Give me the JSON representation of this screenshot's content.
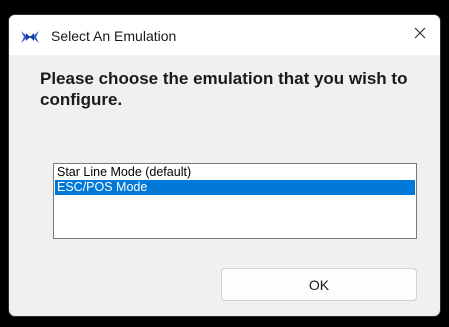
{
  "window": {
    "title": "Select An Emulation",
    "icon": "emulation-app-icon",
    "close_icon": "close-icon"
  },
  "prompt": "Please choose the emulation that you wish to configure.",
  "emulations": {
    "items": [
      {
        "label": "Star Line Mode (default)",
        "selected": false
      },
      {
        "label": "ESC/POS Mode",
        "selected": true
      }
    ]
  },
  "buttons": {
    "ok_label": "OK"
  },
  "colors": {
    "selection": "#0078d7",
    "window_bg": "#f0f0f0",
    "titlebar_bg": "#ffffff"
  }
}
